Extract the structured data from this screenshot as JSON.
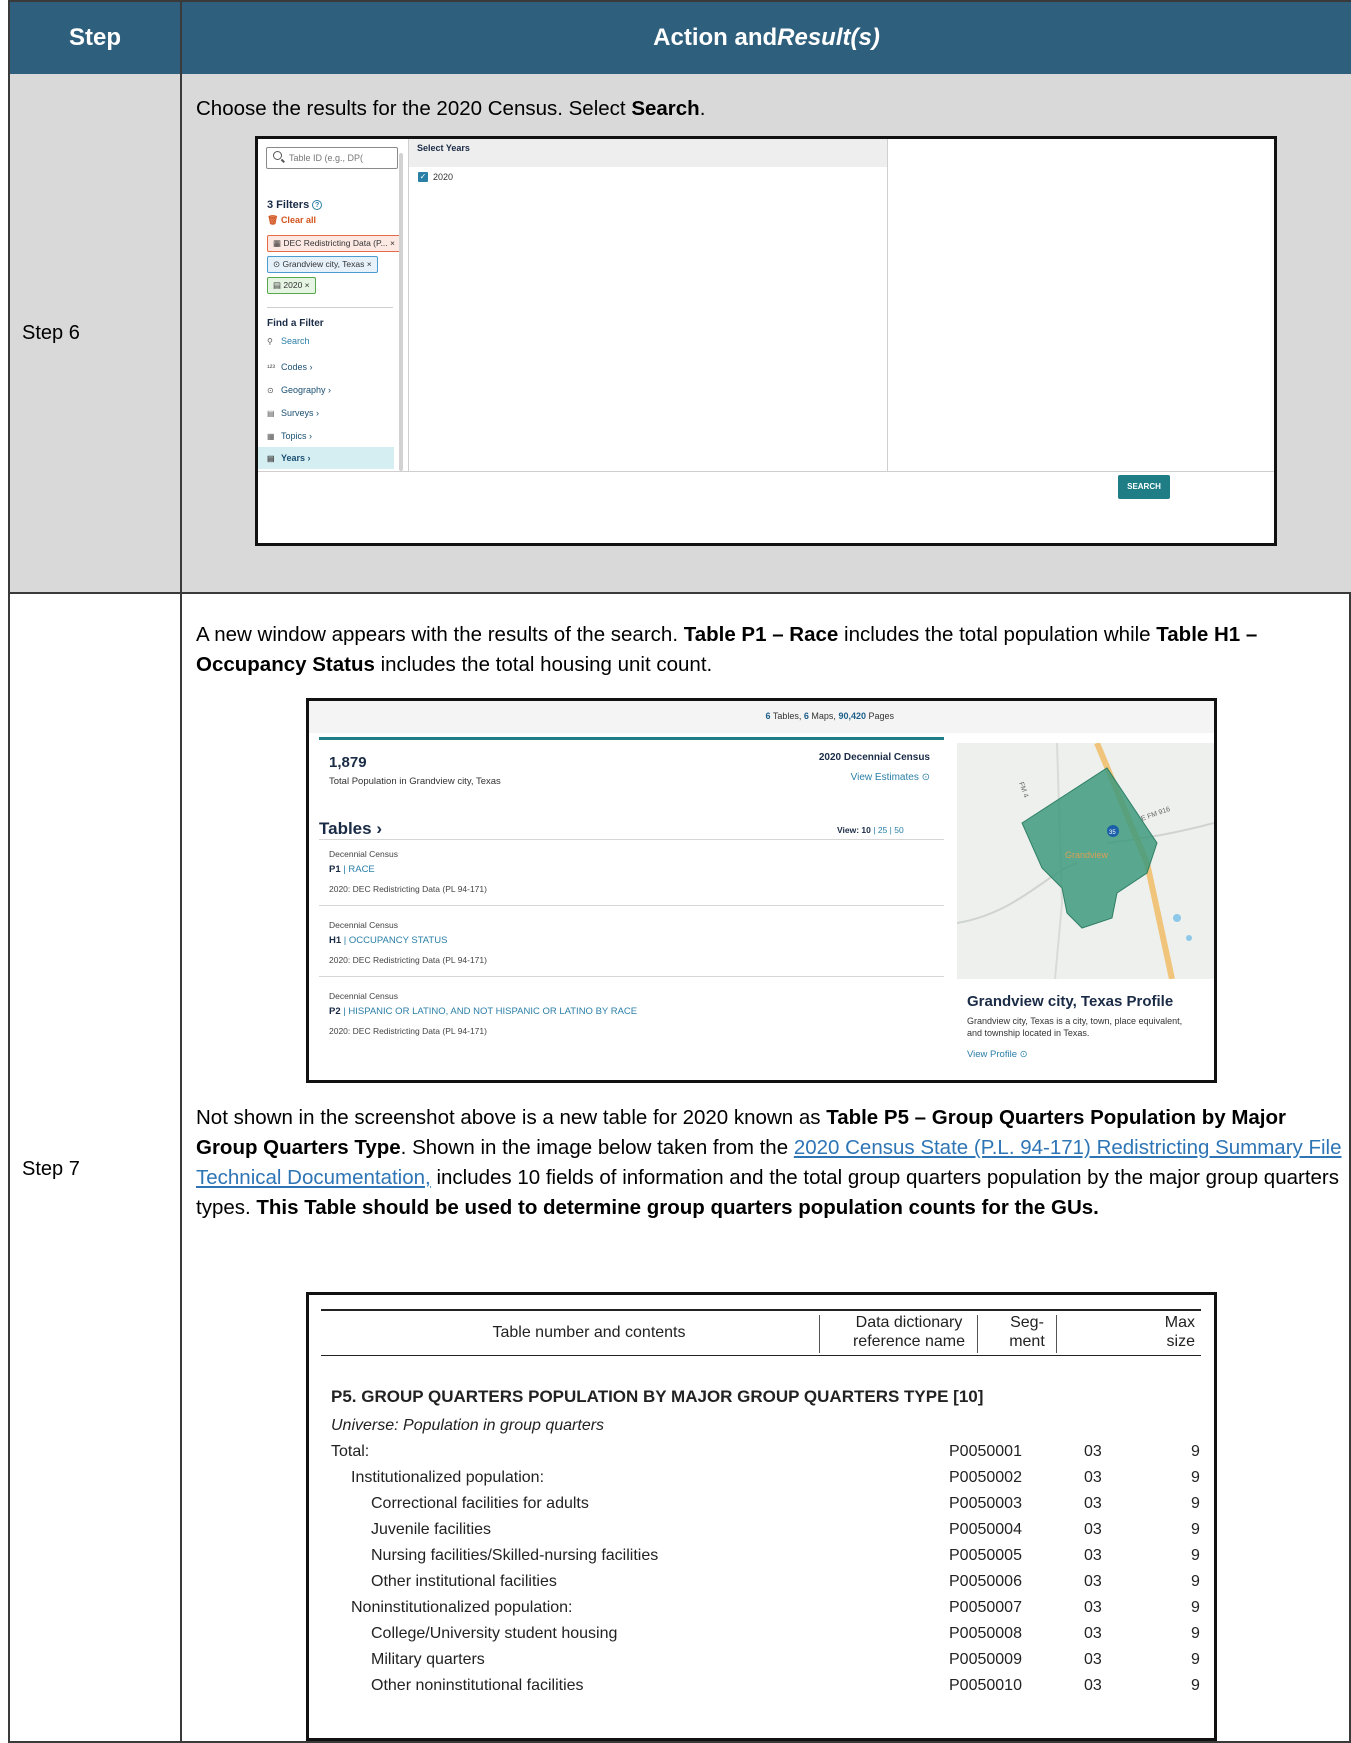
{
  "header": {
    "step": "Step",
    "action": "Action and ",
    "result": "Result(s)"
  },
  "step6": {
    "label": "Step 6",
    "text": "Choose the results for the 2020 Census. Select ",
    "text_bold": "Search",
    "text_end": ".",
    "screenshot": {
      "search_placeholder": "Table ID (e.g., DP(",
      "filters_title": "3 Filters",
      "clear_all": "Clear all",
      "chips": [
        "DEC Redistricting Data (P...  ×",
        "Grandview city, Texas  ×",
        "2020  ×"
      ],
      "find_filter": "Find a Filter",
      "search_link": "Search",
      "nav": [
        "Codes  ›",
        "Geography  ›",
        "Surveys  ›",
        "Topics  ›",
        "Years  ›"
      ],
      "select_years": "Select Years",
      "year_option": "2020",
      "search_button": "SEARCH"
    }
  },
  "step7": {
    "label": "Step 7",
    "p1_a": "A new window appears with the results of the search. ",
    "p1_b": "Table P1 – Race",
    "p1_c": " includes the total population while ",
    "p1_d": "Table H1 – Occupancy Status",
    "p1_e": " includes the total housing unit count.",
    "screenshot": {
      "top_tables_n": "6",
      "top_tables": " Tables, ",
      "top_maps_n": "6",
      "top_maps": " Maps, ",
      "top_pages_n": "90,420",
      "top_pages": " Pages",
      "population": "1,879",
      "population_label": "Total Population in Grandview city, Texas",
      "census_label": "2020 Decennial Census",
      "view_estimates": "View Estimates",
      "tables_heading": "Tables  ›",
      "view_label": "View: ",
      "view_options": [
        "10",
        "25",
        "50"
      ],
      "records": [
        {
          "source": "Decennial Census",
          "id": "P1",
          "name": "RACE",
          "dataset": "2020: DEC Redistricting Data (PL 94-171)"
        },
        {
          "source": "Decennial Census",
          "id": "H1",
          "name": "OCCUPANCY STATUS",
          "dataset": "2020: DEC Redistricting Data (PL 94-171)"
        },
        {
          "source": "Decennial Census",
          "id": "P2",
          "name": "HISPANIC OR LATINO, AND NOT HISPANIC OR LATINO BY RACE",
          "dataset": "2020: DEC Redistricting Data (PL 94-171)"
        }
      ],
      "map_labels": [
        "FM 4",
        "E FM 916",
        "35",
        "Grandview"
      ],
      "profile_title": "Grandview city, Texas Profile",
      "profile_desc": "Grandview city, Texas is a city, town, place equivalent, and township located in Texas.",
      "view_profile": "View Profile"
    },
    "p2_a": "Not shown in the screenshot above is a new table for 2020 known as ",
    "p2_b": "Table P5 – Group Quarters Population by Major Group Quarters Type",
    "p2_c": ". Shown in the image below taken from the ",
    "p2_link": "2020 Census State (P.L. 94-171) Redistricting Summary File Technical Documentation,",
    "p2_d": " includes 10 fields of information and the total group quarters population by the major group quarters types. ",
    "p2_e": "This Table should be used to determine group quarters population counts for the GUs.",
    "doc_table": {
      "col1": "Table number and contents",
      "col2a": "Data dictionary",
      "col2b": "reference name",
      "col3a": "Seg-",
      "col3b": "ment",
      "col4a": "Max",
      "col4b": "size",
      "title": "P5. GROUP QUARTERS POPULATION BY MAJOR GROUP QUARTERS TYPE [10]",
      "universe": "Universe: Population in group quarters",
      "rows": [
        {
          "label": "Total:",
          "ref": "P0050001",
          "seg": "03",
          "max": "9",
          "indent": 0
        },
        {
          "label": "Institutionalized population:",
          "ref": "P0050002",
          "seg": "03",
          "max": "9",
          "indent": 1
        },
        {
          "label": "Correctional facilities for adults",
          "ref": "P0050003",
          "seg": "03",
          "max": "9",
          "indent": 2
        },
        {
          "label": "Juvenile facilities",
          "ref": "P0050004",
          "seg": "03",
          "max": "9",
          "indent": 2
        },
        {
          "label": "Nursing facilities/Skilled-nursing facilities",
          "ref": "P0050005",
          "seg": "03",
          "max": "9",
          "indent": 2
        },
        {
          "label": "Other institutional facilities",
          "ref": "P0050006",
          "seg": "03",
          "max": "9",
          "indent": 2
        },
        {
          "label": "Noninstitutionalized population:",
          "ref": "P0050007",
          "seg": "03",
          "max": "9",
          "indent": 1
        },
        {
          "label": "College/University student housing",
          "ref": "P0050008",
          "seg": "03",
          "max": "9",
          "indent": 2
        },
        {
          "label": "Military quarters",
          "ref": "P0050009",
          "seg": "03",
          "max": "9",
          "indent": 2
        },
        {
          "label": "Other noninstitutional facilities",
          "ref": "P0050010",
          "seg": "03",
          "max": "9",
          "indent": 2
        }
      ]
    }
  }
}
